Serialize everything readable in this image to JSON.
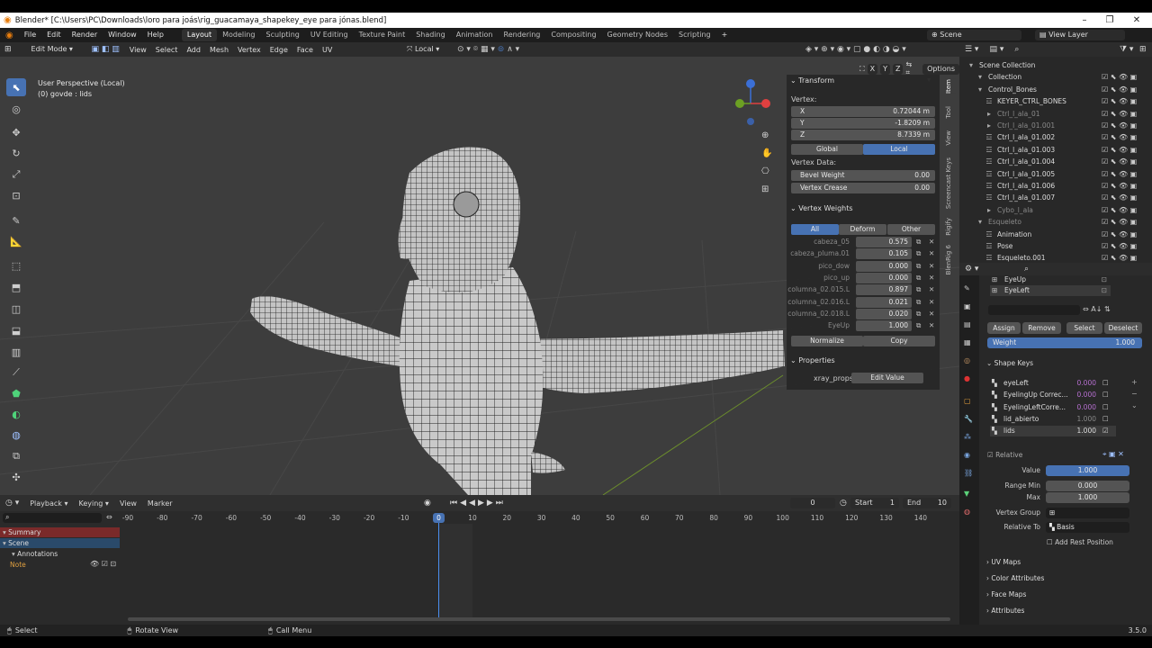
{
  "window": {
    "title": "Blender* [C:\\Users\\PC\\Downloads\\loro para joás\\rig_guacamaya_shapekey_eye para jónas.blend]"
  },
  "topmenu": [
    "File",
    "Edit",
    "Render",
    "Window",
    "Help"
  ],
  "workspaces": [
    "Layout",
    "Modeling",
    "Sculpting",
    "UV Editing",
    "Texture Paint",
    "Shading",
    "Animation",
    "Rendering",
    "Compositing",
    "Geometry Nodes",
    "Scripting"
  ],
  "scene": "Scene",
  "view_layer": "View Layer",
  "viewport": {
    "mode": "Edit Mode",
    "menus": [
      "View",
      "Select",
      "Add",
      "Mesh",
      "Vertex",
      "Edge",
      "Face",
      "UV"
    ],
    "orientation": "Local",
    "perspective": "User Perspective (Local)",
    "object": "(0) govde : lids",
    "options": "Options",
    "xyz": [
      "X",
      "Y",
      "Z"
    ]
  },
  "npanel": {
    "tabs": [
      "Item",
      "Tool",
      "View",
      "Screencast Keys",
      "Rigify",
      "BlenRig 6"
    ],
    "transform": "Transform",
    "vertex_label": "Vertex:",
    "coords": [
      {
        "axis": "X",
        "value": "0.72044 m"
      },
      {
        "axis": "Y",
        "value": "-1.8209 m"
      },
      {
        "axis": "Z",
        "value": "8.7339 m"
      }
    ],
    "global": "Global",
    "local": "Local",
    "vertex_data": "Vertex Data:",
    "bevel_weight": {
      "label": "Bevel Weight",
      "value": "0.00"
    },
    "vertex_crease": {
      "label": "Vertex Crease",
      "value": "0.00"
    },
    "vertex_weights": "Vertex Weights",
    "vw_tabs": [
      "All",
      "Deform",
      "Other"
    ],
    "weights": [
      {
        "name": "cabeza_05",
        "value": "0.575"
      },
      {
        "name": "cabeza_pluma.01",
        "value": "0.105"
      },
      {
        "name": "pico_dow",
        "value": "0.000"
      },
      {
        "name": "pico_up",
        "value": "0.000"
      },
      {
        "name": "columna_02.015.L",
        "value": "0.897"
      },
      {
        "name": "columna_02.016.L",
        "value": "0.021"
      },
      {
        "name": "columna_02.018.L",
        "value": "0.020"
      },
      {
        "name": "EyeUp",
        "value": "1.000"
      }
    ],
    "normalize": "Normalize",
    "copy": "Copy",
    "properties": "Properties",
    "xray_props": "xray_props",
    "edit_value": "Edit Value"
  },
  "outliner": {
    "rows": [
      {
        "name": "Scene Collection",
        "indent": 0,
        "dim": false
      },
      {
        "name": "Collection",
        "indent": 1,
        "dim": false
      },
      {
        "name": "Control_Bones",
        "indent": 1,
        "dim": false
      },
      {
        "name": "KEYER_CTRL_BONES",
        "indent": 2,
        "dim": false
      },
      {
        "name": "Ctrl_l_ala_01",
        "indent": 2,
        "dim": true
      },
      {
        "name": "Ctrl_l_ala_01.001",
        "indent": 2,
        "dim": true
      },
      {
        "name": "Ctrl_l_ala_01.002",
        "indent": 2,
        "dim": false
      },
      {
        "name": "Ctrl_l_ala_01.003",
        "indent": 2,
        "dim": false
      },
      {
        "name": "Ctrl_l_ala_01.004",
        "indent": 2,
        "dim": false
      },
      {
        "name": "Ctrl_l_ala_01.005",
        "indent": 2,
        "dim": false
      },
      {
        "name": "Ctrl_l_ala_01.006",
        "indent": 2,
        "dim": false
      },
      {
        "name": "Ctrl_l_ala_01.007",
        "indent": 2,
        "dim": false
      },
      {
        "name": "Cybo_l_ala",
        "indent": 2,
        "dim": true
      },
      {
        "name": "Esqueleto",
        "indent": 1,
        "dim": true
      },
      {
        "name": "Animation",
        "indent": 2,
        "dim": false
      },
      {
        "name": "Pose",
        "indent": 2,
        "dim": false
      },
      {
        "name": "Esqueleto.001",
        "indent": 2,
        "dim": false
      }
    ]
  },
  "properties": {
    "vgroups": [
      "EyeUp",
      "EyeLeft"
    ],
    "assign": "Assign",
    "remove": "Remove",
    "select": "Select",
    "deselect": "Deselect",
    "weight": {
      "label": "Weight",
      "value": "1.000"
    },
    "shape_keys_title": "Shape Keys",
    "shape_keys": [
      {
        "name": "eyeLeft",
        "value": "0.000",
        "active": false
      },
      {
        "name": "EyelingUp Correc...",
        "value": "0.000",
        "active": false
      },
      {
        "name": "EyelingLeftCorre...",
        "value": "0.000",
        "active": false
      },
      {
        "name": "lid_abierto",
        "value": "1.000",
        "active": false
      },
      {
        "name": "lids",
        "value": "1.000",
        "active": true
      }
    ],
    "relative": "Relative",
    "value": {
      "label": "Value",
      "value": "1.000"
    },
    "range_min": {
      "label": "Range Min",
      "value": "0.000"
    },
    "max": {
      "label": "Max",
      "value": "1.000"
    },
    "vertex_group": "Vertex Group",
    "relative_to": {
      "label": "Relative To",
      "value": "Basis"
    },
    "add_rest": "Add Rest Position",
    "sections": [
      "UV Maps",
      "Color Attributes",
      "Face Maps",
      "Attributes"
    ]
  },
  "timeline": {
    "menus": [
      "Playback",
      "Keying",
      "View",
      "Marker"
    ],
    "current_frame": "0",
    "start_label": "Start",
    "start": "1",
    "end_label": "End",
    "end": "10",
    "ticks": [
      "-90",
      "-80",
      "-70",
      "-60",
      "-50",
      "-40",
      "-30",
      "-20",
      "-10",
      "0",
      "10",
      "20",
      "30",
      "40",
      "50",
      "60",
      "70",
      "80",
      "90",
      "100",
      "110",
      "120",
      "130",
      "140"
    ],
    "channels": [
      "Summary",
      "Scene",
      "Annotations",
      "Note"
    ],
    "playhead": "0"
  },
  "status": {
    "select": "Select",
    "rotate": "Rotate View",
    "menu": "Call Menu",
    "version": "3.5.0"
  },
  "colors": {
    "accent": "#4772b3",
    "header": "#1d1d1d",
    "viewport": "#3d3d3d"
  }
}
